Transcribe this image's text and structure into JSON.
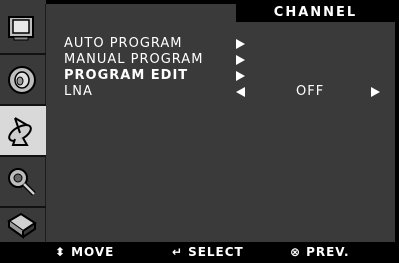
{
  "header": {
    "title": "CHANNEL"
  },
  "sidebar": {
    "tabs": [
      {
        "icon": "picture-icon"
      },
      {
        "icon": "sound-icon"
      },
      {
        "icon": "channel-antenna-icon",
        "active": true
      },
      {
        "icon": "setup-wrench-icon"
      },
      {
        "icon": "function-icon"
      }
    ]
  },
  "menu": {
    "items": [
      {
        "label": "AUTO PROGRAM"
      },
      {
        "label": "MANUAL PROGRAM"
      },
      {
        "label": "PROGRAM EDIT",
        "selected": true
      },
      {
        "label": "LNA",
        "value": "OFF"
      }
    ]
  },
  "footer": {
    "move": {
      "glyph": "⬍",
      "label": "MOVE"
    },
    "select": {
      "glyph": "↵",
      "label": "SELECT"
    },
    "prev": {
      "glyph": "⊗",
      "label": "PREV."
    }
  },
  "colors": {
    "panel": "#3a3a3a",
    "text": "#ffffff",
    "background": "#000000",
    "active_tab": "#d9d9d9"
  }
}
